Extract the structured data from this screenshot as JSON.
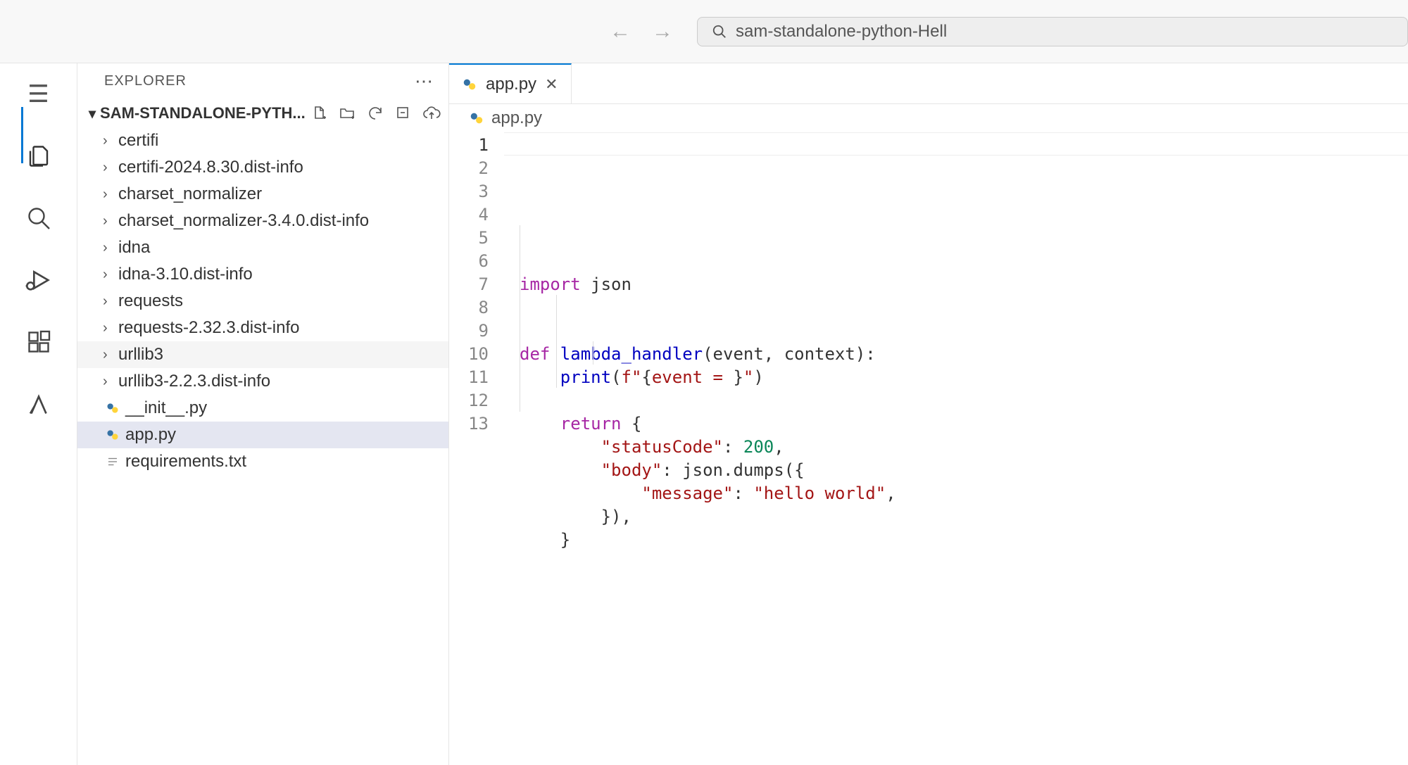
{
  "topbar": {
    "search_text": "sam-standalone-python-Hell"
  },
  "sidebar": {
    "title": "EXPLORER",
    "project_name": "SAM-STANDALONE-PYTH...",
    "tree": [
      {
        "label": "certifi",
        "type": "folder"
      },
      {
        "label": "certifi-2024.8.30.dist-info",
        "type": "folder"
      },
      {
        "label": "charset_normalizer",
        "type": "folder"
      },
      {
        "label": "charset_normalizer-3.4.0.dist-info",
        "type": "folder"
      },
      {
        "label": "idna",
        "type": "folder"
      },
      {
        "label": "idna-3.10.dist-info",
        "type": "folder"
      },
      {
        "label": "requests",
        "type": "folder"
      },
      {
        "label": "requests-2.32.3.dist-info",
        "type": "folder"
      },
      {
        "label": "urllib3",
        "type": "folder",
        "hover": true
      },
      {
        "label": "urllib3-2.2.3.dist-info",
        "type": "folder"
      },
      {
        "label": "__init__.py",
        "type": "py"
      },
      {
        "label": "app.py",
        "type": "py",
        "selected": true
      },
      {
        "label": "requirements.txt",
        "type": "txt"
      }
    ]
  },
  "editor": {
    "tab_label": "app.py",
    "breadcrumb": "app.py",
    "lines": [
      {
        "n": 1,
        "tokens": [
          {
            "t": "import ",
            "c": "kw"
          },
          {
            "t": "json",
            "c": ""
          }
        ],
        "active": true
      },
      {
        "n": 2,
        "tokens": []
      },
      {
        "n": 3,
        "tokens": []
      },
      {
        "n": 4,
        "tokens": [
          {
            "t": "def ",
            "c": "kw"
          },
          {
            "t": "lambda_handler",
            "c": "fn"
          },
          {
            "t": "(event, context):",
            "c": ""
          }
        ]
      },
      {
        "n": 5,
        "tokens": [
          {
            "t": "    ",
            "c": ""
          },
          {
            "t": "print",
            "c": "fn"
          },
          {
            "t": "(",
            "c": ""
          },
          {
            "t": "f\"",
            "c": "str"
          },
          {
            "t": "{",
            "c": ""
          },
          {
            "t": "event = ",
            "c": "str"
          },
          {
            "t": "}",
            "c": ""
          },
          {
            "t": "\"",
            "c": "str"
          },
          {
            "t": ")",
            "c": ""
          }
        ]
      },
      {
        "n": 6,
        "tokens": []
      },
      {
        "n": 7,
        "tokens": [
          {
            "t": "    ",
            "c": ""
          },
          {
            "t": "return",
            "c": "kw"
          },
          {
            "t": " {",
            "c": ""
          }
        ]
      },
      {
        "n": 8,
        "tokens": [
          {
            "t": "        ",
            "c": ""
          },
          {
            "t": "\"statusCode\"",
            "c": "str"
          },
          {
            "t": ": ",
            "c": ""
          },
          {
            "t": "200",
            "c": "num"
          },
          {
            "t": ",",
            "c": ""
          }
        ]
      },
      {
        "n": 9,
        "tokens": [
          {
            "t": "        ",
            "c": ""
          },
          {
            "t": "\"body\"",
            "c": "str"
          },
          {
            "t": ": json.dumps({",
            "c": ""
          }
        ]
      },
      {
        "n": 10,
        "tokens": [
          {
            "t": "            ",
            "c": ""
          },
          {
            "t": "\"message\"",
            "c": "str"
          },
          {
            "t": ": ",
            "c": ""
          },
          {
            "t": "\"hello world\"",
            "c": "str"
          },
          {
            "t": ",",
            "c": ""
          }
        ]
      },
      {
        "n": 11,
        "tokens": [
          {
            "t": "        }),",
            "c": ""
          }
        ]
      },
      {
        "n": 12,
        "tokens": [
          {
            "t": "    }",
            "c": ""
          }
        ]
      },
      {
        "n": 13,
        "tokens": []
      }
    ]
  }
}
